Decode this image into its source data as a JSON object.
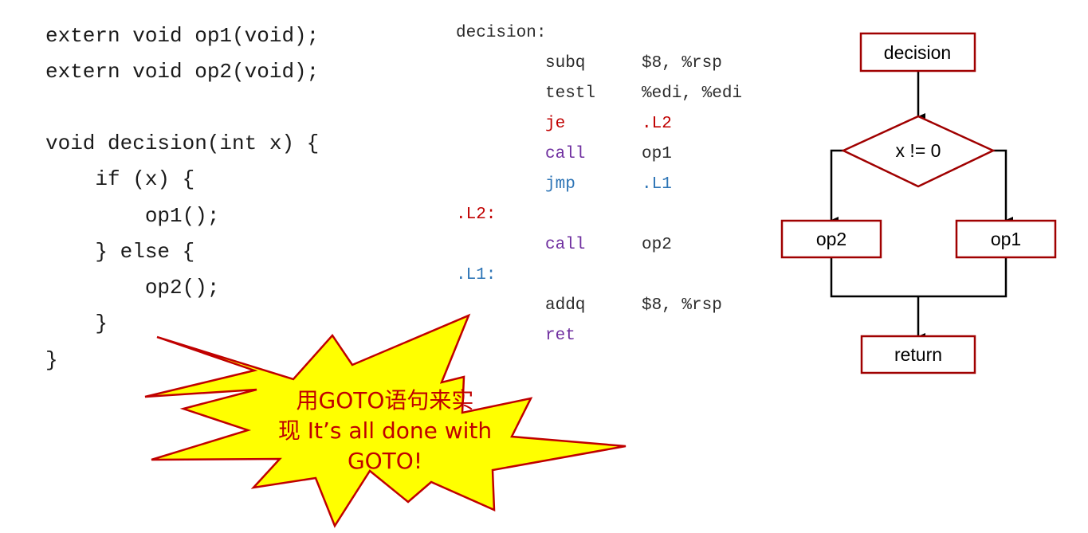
{
  "c_source": {
    "lines": [
      "extern void op1(void);",
      "extern void op2(void);",
      "void decision(int x) {",
      "    if (x) {",
      "        op1();",
      "    } else {",
      "        op2();",
      "    }",
      "}"
    ]
  },
  "assembly": {
    "label_decision": "decision:",
    "label_l2": ".L2:",
    "label_l1": ".L1:",
    "instructions": [
      {
        "op": "subq",
        "arg": "$8, %rsp"
      },
      {
        "op": "testl",
        "arg": "%edi, %edi"
      },
      {
        "op": "je",
        "arg": ".L2"
      },
      {
        "op": "call",
        "arg": "op1"
      },
      {
        "op": "jmp",
        "arg": ".L1"
      },
      {
        "op": "call",
        "arg": "op2"
      },
      {
        "op": "addq",
        "arg": "$8, %rsp"
      },
      {
        "op": "ret",
        "arg": ""
      }
    ]
  },
  "flowchart": {
    "start": "decision",
    "condition": "x != 0",
    "left_box": "op2",
    "right_box": "op1",
    "end": "return",
    "colors": {
      "box_border": "#a00000",
      "line": "#000000"
    }
  },
  "callout": {
    "line1": "用GOTO语句来实",
    "line2": "现 It’s all done with",
    "line3": "GOTO!",
    "colors": {
      "fill": "#ffff00",
      "stroke": "#c00000",
      "text": "#c00000"
    }
  },
  "colors": {
    "label_red": "#c00000",
    "keyword_purple": "#7030a0",
    "jump_blue": "#2e75b6"
  }
}
